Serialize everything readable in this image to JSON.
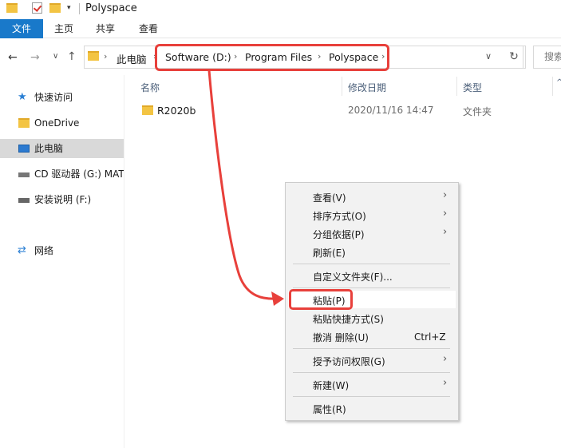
{
  "window": {
    "title": "Polyspace"
  },
  "ribbon": {
    "tabs": [
      "文件",
      "主页",
      "共享",
      "查看"
    ]
  },
  "address": {
    "root": "此电脑",
    "crumbs": [
      "Software (D:)",
      "Program Files",
      "Polyspace"
    ],
    "search_placeholder": "搜索"
  },
  "sidebar": {
    "items": [
      {
        "label": "快速访问",
        "icon": "star-icon"
      },
      {
        "label": "OneDrive",
        "icon": "folder-icon"
      },
      {
        "label": "此电脑",
        "icon": "computer-icon",
        "selected": true
      },
      {
        "label": "CD 驱动器 (G:) MAT",
        "icon": "cd-drive-icon"
      },
      {
        "label": "安装说明 (F:)",
        "icon": "drive-icon"
      },
      {
        "label": "网络",
        "icon": "network-icon"
      }
    ]
  },
  "columns": {
    "name": "名称",
    "date": "修改日期",
    "type": "类型"
  },
  "files": [
    {
      "name": "R2020b",
      "date": "2020/11/16 14:47",
      "type": "文件夹"
    }
  ],
  "context_menu": {
    "items": [
      {
        "label": "查看(V)",
        "submenu": true
      },
      {
        "label": "排序方式(O)",
        "submenu": true
      },
      {
        "label": "分组依据(P)",
        "submenu": true
      },
      {
        "label": "刷新(E)"
      },
      {
        "label": "自定义文件夹(F)..."
      },
      {
        "label": "粘贴(P)"
      },
      {
        "label": "粘贴快捷方式(S)"
      },
      {
        "label": "撤消 删除(U)",
        "shortcut": "Ctrl+Z"
      },
      {
        "label": "授予访问权限(G)",
        "submenu": true
      },
      {
        "label": "新建(W)",
        "submenu": true
      },
      {
        "label": "属性(R)"
      }
    ]
  },
  "colors": {
    "accent": "#1979ca",
    "annotation": "#e8403b",
    "folder": "#f3c443"
  }
}
